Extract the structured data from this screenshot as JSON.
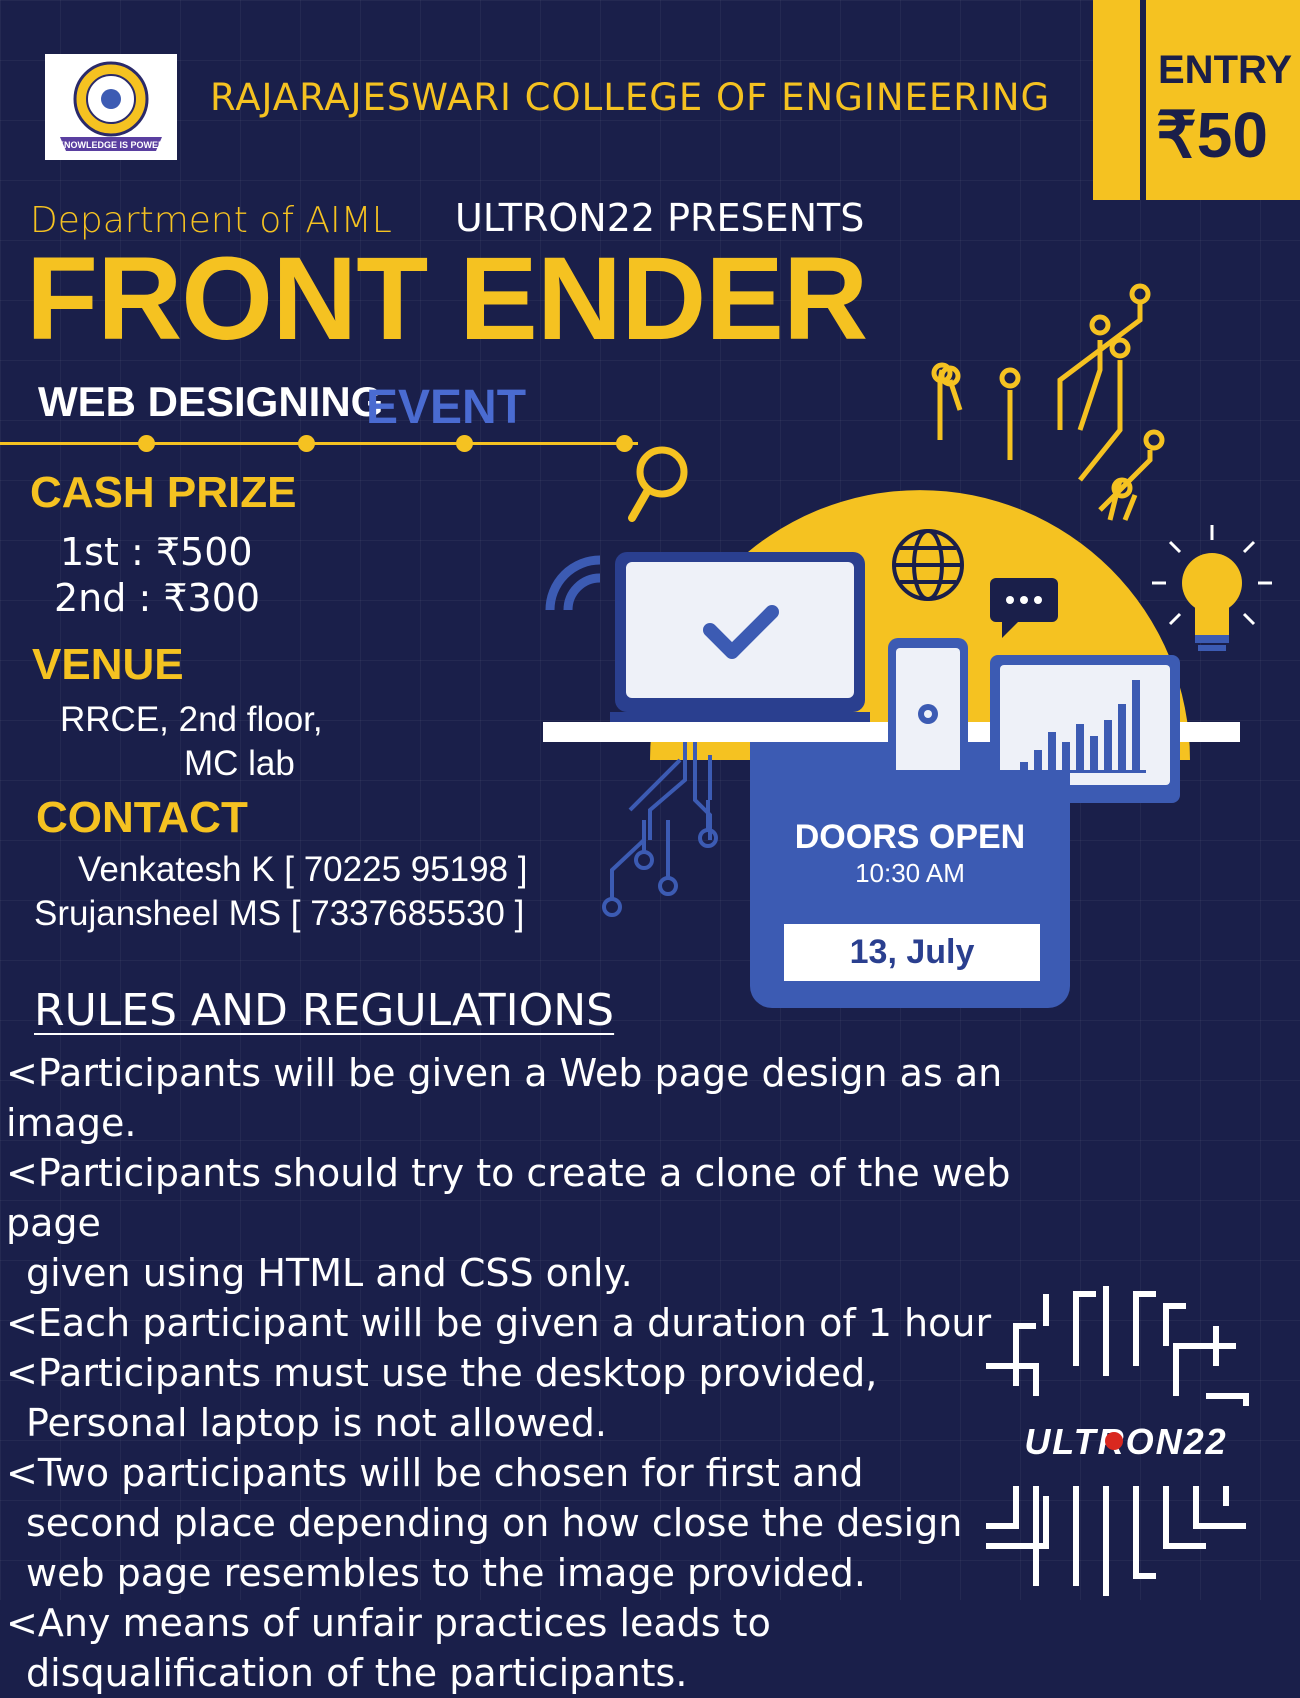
{
  "header": {
    "college": "RAJARAJESWARI COLLEGE OF ENGINEERING",
    "logo_text": "KNOWLEDGE IS POWER"
  },
  "entry": {
    "label": "ENTRY",
    "price": "₹50"
  },
  "event": {
    "department": "Department of AIML",
    "presents": "ULTRON22 PRESENTS",
    "title": "FRONT ENDER",
    "subtitle_a": "WEB DESIGNING",
    "subtitle_b": "EVENT"
  },
  "cash_prize": {
    "heading": "CASH PRIZE",
    "first": "1st : ₹500",
    "second": "2nd : ₹300"
  },
  "venue": {
    "heading": "VENUE",
    "line1": "RRCE, 2nd floor,",
    "line2": "MC lab"
  },
  "contact": {
    "heading": "CONTACT",
    "line1": "Venkatesh K [ 70225 95198 ]",
    "line2": "Srujansheel MS [ 7337685530 ]"
  },
  "doors": {
    "label": "DOORS OPEN",
    "time": "10:30 AM",
    "date": "13, July"
  },
  "rules": {
    "heading": "RULES AND REGULATIONS",
    "items": [
      {
        "first": "<Participants will be given a Web page design as an image.",
        "rest": []
      },
      {
        "first": "<Participants should try to create a clone of the web page",
        "rest": [
          "given using HTML and CSS only."
        ]
      },
      {
        "first": "<Each participant will be given a duration of 1 hour",
        "rest": []
      },
      {
        "first": "<Participants must use the desktop provided,",
        "rest": [
          "Personal laptop is not allowed."
        ]
      },
      {
        "first": "<Two participants will be chosen for first and",
        "rest": [
          "second place depending on how close the design",
          "web page resembles to the image provided."
        ]
      },
      {
        "first": "<Any means of unfair practices leads to",
        "rest": [
          "disqualification of the participants."
        ]
      }
    ]
  },
  "brand": {
    "logo": "ULTRON22"
  },
  "colors": {
    "background": "#1a1f4a",
    "accent": "#f5c221",
    "blue": "#3c5bb3"
  },
  "icons": [
    "college-emblem-icon",
    "magnifier-icon",
    "wifi-icon",
    "laptop-check-icon",
    "globe-icon",
    "chat-bubble-icon",
    "lightbulb-icon",
    "phone-gear-icon",
    "bar-chart-monitor-icon",
    "circuit-icon"
  ]
}
